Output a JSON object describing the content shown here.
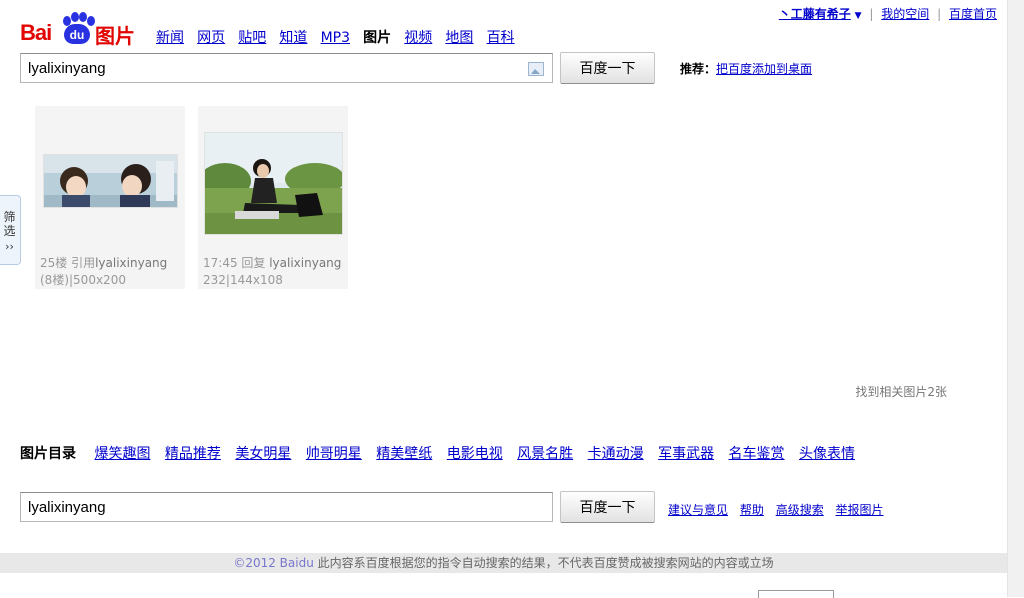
{
  "logo": {
    "bai": "Bai",
    "du": "du",
    "tupian": "图片"
  },
  "topnav": [
    {
      "label": "新闻",
      "active": false
    },
    {
      "label": "网页",
      "active": false
    },
    {
      "label": "贴吧",
      "active": false
    },
    {
      "label": "知道",
      "active": false
    },
    {
      "label": "MP3",
      "active": false
    },
    {
      "label": "图片",
      "active": true
    },
    {
      "label": "视频",
      "active": false
    },
    {
      "label": "地图",
      "active": false
    },
    {
      "label": "百科",
      "active": false
    }
  ],
  "userbar": {
    "username": "丶工藤有希子",
    "space": "我的空间",
    "home": "百度首页",
    "separator": "|"
  },
  "search": {
    "value": "lyalixinyang",
    "button": "百度一下",
    "camera_icon": "camera-image-icon"
  },
  "recommend": {
    "label": "推荐：",
    "link": "把百度添加到桌面"
  },
  "filter_tab": {
    "label": "筛选",
    "arrow": "››"
  },
  "results": [
    {
      "caption_pre": "25楼  引用",
      "caption_name": "lyalixinyang",
      "caption_post": " (8楼)",
      "size": "500x200"
    },
    {
      "caption_pre": "17:45 回复  ",
      "caption_name": "lyalixinyang",
      "caption_post": " 232",
      "size": "144x108"
    }
  ],
  "found_text": "找到相关图片2张",
  "categories": {
    "title": "图片目录",
    "items": [
      "爆笑趣图",
      "精品推荐",
      "美女明星",
      "帅哥明星",
      "精美壁纸",
      "电影电视",
      "风景名胜",
      "卡通动漫",
      "军事武器",
      "名车鉴赏",
      "头像表情"
    ]
  },
  "bottom_search": {
    "value": "lyalixinyang",
    "button": "百度一下"
  },
  "bottom_links": [
    "建议与意见",
    "帮助",
    "高级搜索",
    "举报图片"
  ],
  "footer": {
    "copyright": "©2012 Baidu",
    "text": " 此内容系百度根据您的指令自动搜索的结果，不代表百度赞成被搜索网站的内容或立场"
  },
  "colors": {
    "brand_red": "#e10602",
    "brand_blue": "#2932e1",
    "link": "#0000cc"
  }
}
